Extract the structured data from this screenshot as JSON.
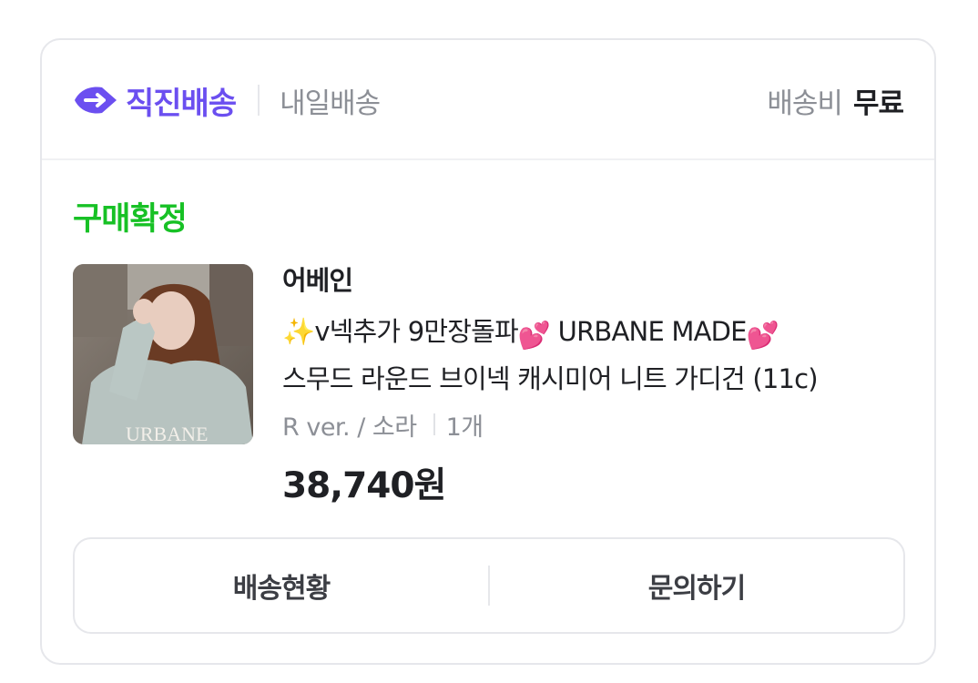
{
  "header": {
    "brand_label": "직진배송",
    "secondary_label": "내일배송",
    "shipping_label": "배송비",
    "shipping_value": "무료",
    "brand_color": "#6b4ff0"
  },
  "order": {
    "status": "구매확정",
    "status_color": "#17c125",
    "seller": "어베인",
    "name_prefix": "✨",
    "name_part1": "v넥추가 9만장돌파",
    "name_part2": "URBANE MADE",
    "name_line2": "스무드 라운드 브이넥 캐시미어 니트 가디건 (11c)",
    "name_emoji": "💕",
    "option": "R ver. / 소라",
    "quantity": "1개",
    "price": "38,740원",
    "thumbnail_text": "URBANE"
  },
  "actions": {
    "track_label": "배송현황",
    "inquiry_label": "문의하기"
  },
  "icons": {
    "brand": "arrow-logo-icon",
    "heart": "heart-emoji-icon",
    "sparkle": "sparkle-emoji-icon"
  }
}
